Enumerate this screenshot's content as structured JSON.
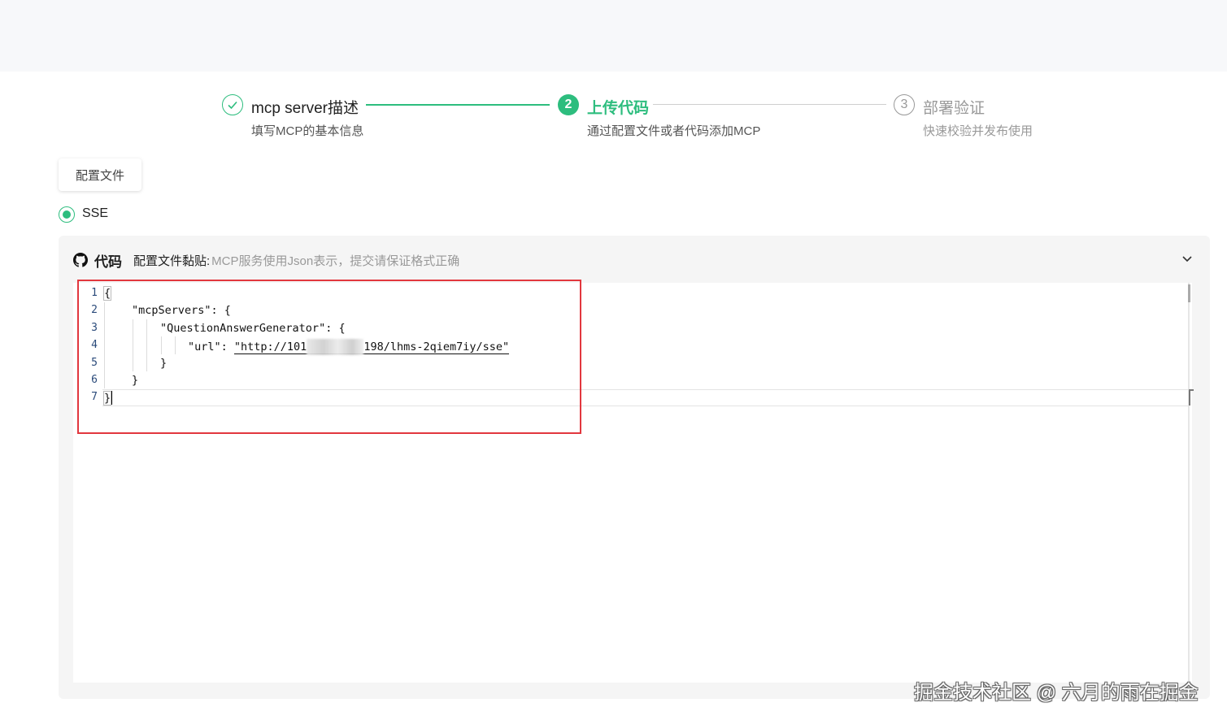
{
  "steps": [
    {
      "number": "✓",
      "title": "mcp server描述",
      "desc": "填写MCP的基本信息",
      "status": "done"
    },
    {
      "number": "2",
      "title": "上传代码",
      "desc": "通过配置文件或者代码添加MCP",
      "status": "active"
    },
    {
      "number": "3",
      "title": "部署验证",
      "desc": "快速校验并发布使用",
      "status": "pending"
    }
  ],
  "tab": {
    "label": "配置文件"
  },
  "transport": {
    "label": "SSE",
    "selected": true
  },
  "panel": {
    "icon": "github-icon",
    "title": "代码",
    "paste_label": "配置文件黏贴:",
    "paste_hint": "MCP服务使用Json表示，提交请保证格式正确",
    "collapse_icon": "chevron-down-icon"
  },
  "editor": {
    "line_numbers": [
      "1",
      "2",
      "3",
      "4",
      "5",
      "6",
      "7"
    ],
    "lines": [
      "{",
      "\"mcpServers\": {",
      "\"QuestionAnswerGenerator\": {",
      "\"url\": ",
      "}",
      "}",
      "}"
    ],
    "url_prefix": "\"http://101",
    "url_suffix": "198/lhms-2qiem7iy/sse\""
  },
  "watermark": "掘金技术社区 @ 六月的雨在掘金",
  "colors": {
    "accent": "#2dbd7e",
    "highlight_box": "#e2373e"
  }
}
